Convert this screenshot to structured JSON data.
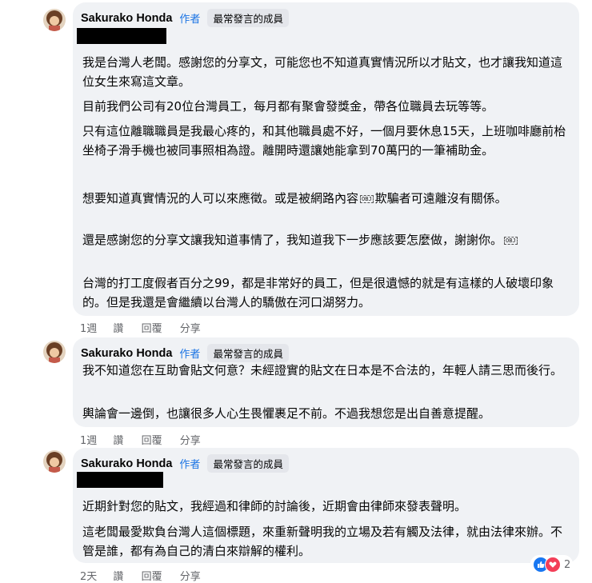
{
  "comments": [
    {
      "author": "Sakurako Honda",
      "role": "作者",
      "badge": "最常發言的成員",
      "paragraphs": [
        "我是台灣人老闆。感謝您的分享文，可能您也不知道真實情況所以才貼文，也才讓我知道這位女生來寫這文章。",
        "目前我們公司有20位台灣員工，每月都有聚會發獎金，帶各位職員去玩等等。",
        "只有這位離職職員是我最心疼的，和其他職員處不好，一個月要休息15天，上班咖啡廳前枱坐椅子滑手機也被同事照相為證。離開時還讓她能拿到70萬円的一筆補助金。",
        {
          "before": "想要知道真實情況的人可以來應徵。或是被網路內容",
          "after": "欺騙者可遠離沒有關係。"
        },
        {
          "before": "還是感謝您的分享文讓我知道事情了，我知道我下一步應該要怎麼做，謝謝你。",
          "after": ""
        },
        "台灣的打工度假者百分之99，都是非常好的員工，但是很遺憾的就是有這樣的人破壞印象的。但是我還是會繼續以台灣人的驕傲在河口湖努力。"
      ],
      "time": "1週",
      "like": "讚",
      "reply": "回覆",
      "share": "分享"
    },
    {
      "author": "Sakurako Honda",
      "role": "作者",
      "badge": "最常發言的成員",
      "paragraphs": [
        "我不知道您在互助會貼文何意？未經證實的貼文在日本是不合法的，年輕人請三思而後行。",
        "輿論會一邊倒，也讓很多人心生畏懼裹足不前。不過我想您是出自善意提醒。"
      ],
      "time": "1週",
      "like": "讚",
      "reply": "回覆",
      "share": "分享"
    },
    {
      "author": "Sakurako Honda",
      "role": "作者",
      "badge": "最常發言的成員",
      "paragraphs": [
        "近期針對您的貼文，我經過和律師的討論後，近期會由律師來發表聲明。",
        "這老闆最愛欺負台灣人這個標題，來重新聲明我的立場及若有觸及法律，就由法律來辦。不管是誰，都有為自己的清白來辯解的權利。"
      ],
      "time": "2天",
      "like": "讚",
      "reply": "回覆",
      "share": "分享",
      "reaction_count": "2"
    }
  ],
  "obj_glyph": "OBJ",
  "icons": {
    "avatar": "avatar-icon",
    "like": "like-reaction-icon",
    "love": "love-reaction-icon"
  },
  "colors": {
    "author": "#1b74e4",
    "bubble": "#f0f2f5",
    "badge": "#e4e6eb",
    "like": "#1877f2",
    "love": "#f33e58",
    "meta": "#65676b"
  }
}
